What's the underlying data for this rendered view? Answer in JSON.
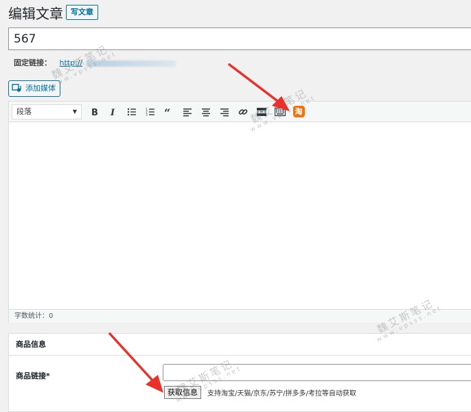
{
  "header": {
    "title": "编辑文章",
    "new_post_label": "写文章"
  },
  "post": {
    "title_value": "567",
    "permalink_label": "固定链接：",
    "permalink_url": "http://"
  },
  "add_media": {
    "label": "添加媒体"
  },
  "toolbar": {
    "format_value": "段落",
    "buttons": [
      {
        "icon": "bold-icon"
      },
      {
        "icon": "italic-icon"
      },
      {
        "icon": "bulleted-list-icon"
      },
      {
        "icon": "numbered-list-icon"
      },
      {
        "icon": "blockquote-icon"
      },
      {
        "icon": "align-left-icon"
      },
      {
        "icon": "align-center-icon"
      },
      {
        "icon": "align-right-icon"
      },
      {
        "icon": "link-icon"
      },
      {
        "icon": "read-more-icon"
      },
      {
        "icon": "toolbar-toggle-icon"
      },
      {
        "icon": "taobao-icon",
        "text": "淘"
      }
    ]
  },
  "statusbar": {
    "word_count_label": "字数统计：",
    "word_count": "0"
  },
  "product_box": {
    "title": "商品信息",
    "link_label": "商品链接*",
    "link_value": "",
    "fetch_button_label": "获取信息",
    "fetch_hint": "支持淘宝/天猫/京东/苏宁/拼多多/考拉等自动获取"
  },
  "watermark": {
    "name": "魏艾斯笔记",
    "site": "www.vpsss.net"
  },
  "colors": {
    "accent": "#0071a1",
    "annotation_arrow": "#e8312a",
    "taobao_orange": "#f2720c"
  }
}
